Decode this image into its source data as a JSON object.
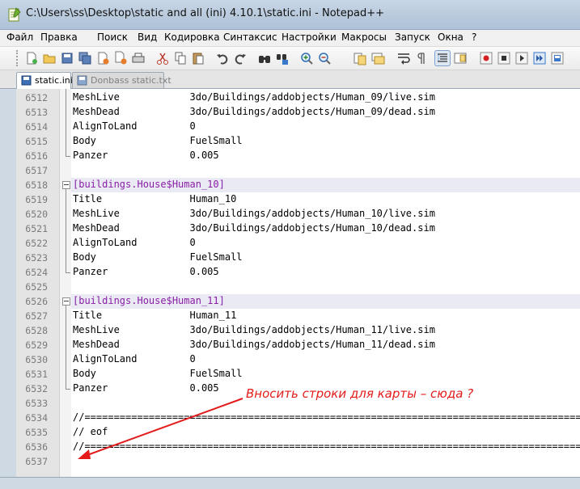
{
  "window": {
    "title": "C:\\Users\\ss\\Desktop\\static and all (ini) 4.10.1\\static.ini - Notepad++"
  },
  "menu": [
    "Файл",
    "Правка",
    "Поиск",
    "Вид",
    "Кодировка",
    "Синтаксис",
    "Настройки",
    "Макросы",
    "Запуск",
    "Окна",
    "?"
  ],
  "toolbar": {
    "buttons": [
      "new-file",
      "open-file",
      "save",
      "save-all",
      "close",
      "close-all",
      "print",
      "cut",
      "copy",
      "paste",
      "undo",
      "redo",
      "find",
      "replace",
      "zoom-in",
      "zoom-out",
      "sync-vertical",
      "sync-horizontal",
      "word-wrap",
      "show-all-chars",
      "indent-guide",
      "doc-map",
      "record-macro",
      "stop-recording",
      "play-macro",
      "run-macro-multiple",
      "save-macro"
    ],
    "active": [
      "indent-guide"
    ]
  },
  "tabs": [
    {
      "label": "static.ini",
      "active": true
    },
    {
      "label": "Donbass static.txt",
      "active": false
    }
  ],
  "editor": {
    "lines": [
      {
        "num": "6512",
        "text": "MeshLive            3do/Buildings/addobjects/Human_09/live.sim"
      },
      {
        "num": "6513",
        "text": "MeshDead            3do/Buildings/addobjects/Human_09/dead.sim"
      },
      {
        "num": "6514",
        "text": "AlignToLand         0"
      },
      {
        "num": "6515",
        "text": "Body                FuelSmall"
      },
      {
        "num": "6516",
        "text": "Panzer              0.005"
      },
      {
        "num": "6517",
        "text": ""
      },
      {
        "num": "6518",
        "text": "[buildings.House$Human_10]",
        "section": true
      },
      {
        "num": "6519",
        "text": "Title               Human_10"
      },
      {
        "num": "6520",
        "text": "MeshLive            3do/Buildings/addobjects/Human_10/live.sim"
      },
      {
        "num": "6521",
        "text": "MeshDead            3do/Buildings/addobjects/Human_10/dead.sim"
      },
      {
        "num": "6522",
        "text": "AlignToLand         0"
      },
      {
        "num": "6523",
        "text": "Body                FuelSmall"
      },
      {
        "num": "6524",
        "text": "Panzer              0.005"
      },
      {
        "num": "6525",
        "text": ""
      },
      {
        "num": "6526",
        "text": "[buildings.House$Human_11]",
        "section": true
      },
      {
        "num": "6527",
        "text": "Title               Human_11"
      },
      {
        "num": "6528",
        "text": "MeshLive            3do/Buildings/addobjects/Human_11/live.sim"
      },
      {
        "num": "6529",
        "text": "MeshDead            3do/Buildings/addobjects/Human_11/dead.sim"
      },
      {
        "num": "6530",
        "text": "AlignToLand         0"
      },
      {
        "num": "6531",
        "text": "Body                FuelSmall"
      },
      {
        "num": "6532",
        "text": "Panzer              0.005"
      },
      {
        "num": "6533",
        "text": ""
      },
      {
        "num": "6534",
        "text": "//============================================================================================"
      },
      {
        "num": "6535",
        "text": "// eof"
      },
      {
        "num": "6536",
        "text": "//============================================================================================"
      },
      {
        "num": "6537",
        "text": ""
      }
    ]
  },
  "annotation": {
    "text": "Вносить строки для карты – сюда ?",
    "color": "#e31b1b"
  }
}
